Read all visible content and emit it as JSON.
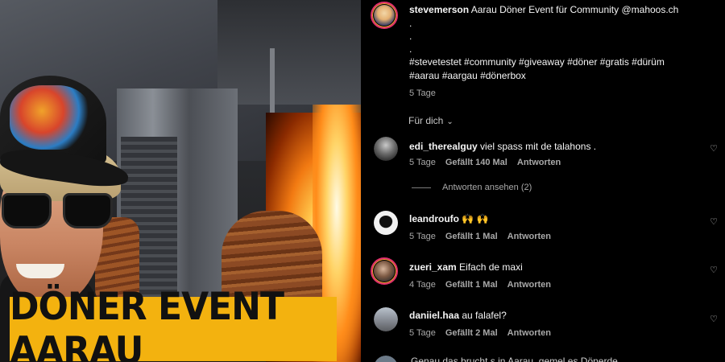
{
  "media": {
    "banner_text": "DÖNER EVENT AARAU"
  },
  "caption": {
    "username": "stevemerson",
    "text": "Aarau Döner Event für Community @mahoos.ch",
    "dots": [
      ".",
      ".",
      "."
    ],
    "hashtags_line1": "#stevetestet #community #giveaway #döner #gratis #dürüm",
    "hashtags_line2": "#aarau #aargau #dönerbox",
    "time": "5 Tage"
  },
  "filter": {
    "label": "Für dich",
    "chevron": "⌄"
  },
  "comments": [
    {
      "username": "edi_therealguy",
      "text": "viel spass mit de talahons .",
      "time": "5 Tage",
      "likes": "Gefällt 140 Mal",
      "reply": "Antworten",
      "view_replies": "Antworten ansehen (2)",
      "avatar_color": "#6a6a6a"
    },
    {
      "username": "leandroufo",
      "text": "🙌 🙌",
      "time": "5 Tage",
      "likes": "Gefällt 1 Mal",
      "reply": "Antworten",
      "avatar_color": "#f2f2f2"
    },
    {
      "username": "zueri_xam",
      "text": "Eifach de maxi",
      "time": "4 Tage",
      "likes": "Gefällt 1 Mal",
      "reply": "Antworten",
      "avatar_color": "#7d5a44"
    },
    {
      "username": "daniiel.haa",
      "text": "au falafel?",
      "time": "5 Tage",
      "likes": "Gefällt 2 Mal",
      "reply": "Antworten",
      "avatar_color": "#8a8f98"
    }
  ],
  "cutoff_text": "Genau das brucht s in Aarau, gemel es Dönerde...",
  "heart_icon": "♡",
  "accent": "#e1306c",
  "banner_color": "#f3b20f"
}
